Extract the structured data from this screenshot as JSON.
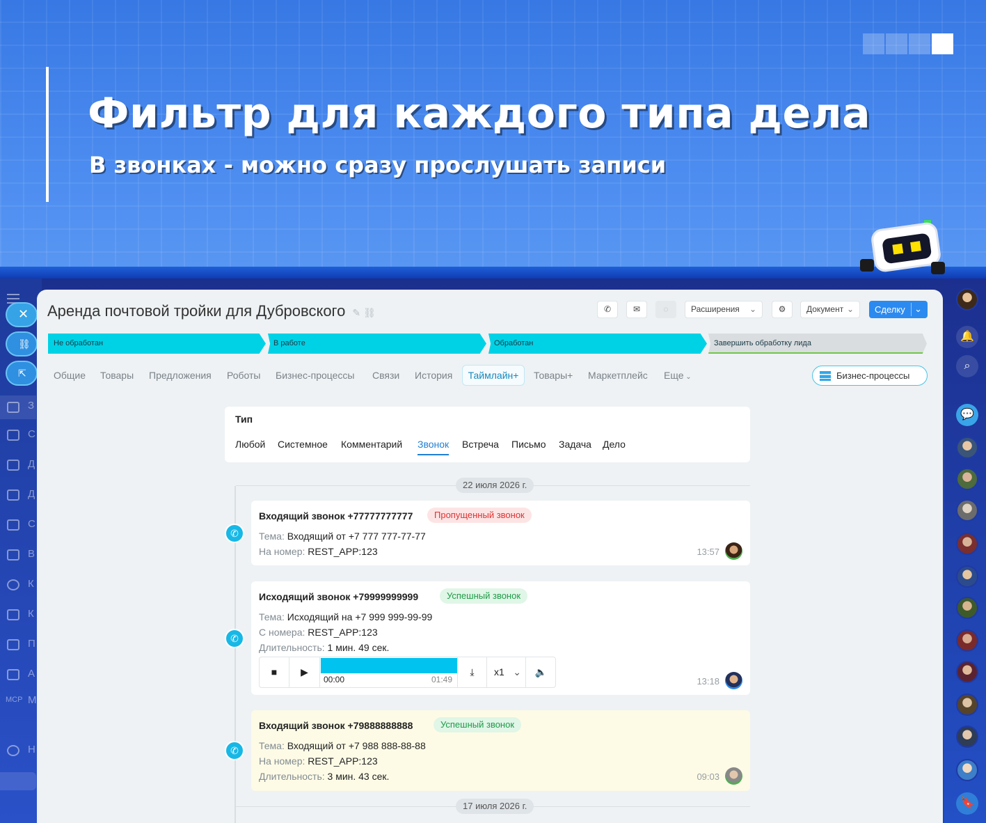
{
  "banner": {
    "title": "Фильтр для каждого типа дела",
    "subtitle": "В звонках - можно сразу прослушать записи"
  },
  "colors": {
    "accent": "#2b8af0",
    "stage": "#00d2e6",
    "banner": "#3f80e8",
    "missed": "#d33",
    "success": "#1f9a48"
  },
  "left_nav": {
    "items": [
      "З",
      "С",
      "Д",
      "Д",
      "С",
      "В",
      "К",
      "К",
      "П",
      "А",
      "Н"
    ],
    "mcp_label": "MCP",
    "cut_label": "М",
    "pill_icons": [
      "close-icon",
      "link-icon",
      "external-link-icon"
    ]
  },
  "deal": {
    "title": "Аренда почтовой тройки для Дубровского",
    "toolbar": {
      "extensions": "Расширения",
      "document": "Документ",
      "create": "Сделку"
    },
    "stages": [
      "Не обработан",
      "В работе",
      "Обработан",
      "Завершить обработку лида"
    ],
    "tabs": [
      "Общие",
      "Товары",
      "Предложения",
      "Роботы",
      "Бизнес-процессы",
      "Связи",
      "История",
      "Таймлайн+",
      "Товары+",
      "Маркетплейс",
      "Еще"
    ],
    "active_tab": "Таймлайн+",
    "bp_button": "Бизнес-процессы"
  },
  "filter": {
    "title": "Тип",
    "options": [
      "Любой",
      "Системное",
      "Комментарий",
      "Звонок",
      "Встреча",
      "Письмо",
      "Задача",
      "Дело"
    ],
    "active": "Звонок"
  },
  "timeline": {
    "dates": [
      "22 июля 2026 г.",
      "17 июля 2026 г."
    ],
    "items": [
      {
        "title": "Входящий звонок +77777777777",
        "badge": "Пропущенный звонок",
        "rows": [
          [
            "Тема:",
            "Входящий от +7 777 777-77-77"
          ],
          [
            "На номер:",
            "REST_APP:123"
          ]
        ],
        "time": "13:57"
      },
      {
        "title": "Исходящий звонок +79999999999",
        "badge": "Успешный звонок",
        "rows": [
          [
            "Тема:",
            "Исходящий на +7 999 999-99-99"
          ],
          [
            "С номера:",
            "REST_APP:123"
          ],
          [
            "Длительность:",
            "1 мин. 49 сек."
          ]
        ],
        "player": {
          "current": "00:00",
          "total": "01:49",
          "speed": "x1",
          "progress": 1.0
        },
        "time": "13:18"
      },
      {
        "title": "Входящий звонок +79888888888",
        "badge": "Успешный звонок",
        "rows": [
          [
            "Тема:",
            "Входящий от +7 988 888-88-88"
          ],
          [
            "На номер:",
            "REST_APP:123"
          ],
          [
            "Длительность:",
            "3 мин. 43 сек."
          ]
        ],
        "time": "09:03"
      }
    ]
  }
}
